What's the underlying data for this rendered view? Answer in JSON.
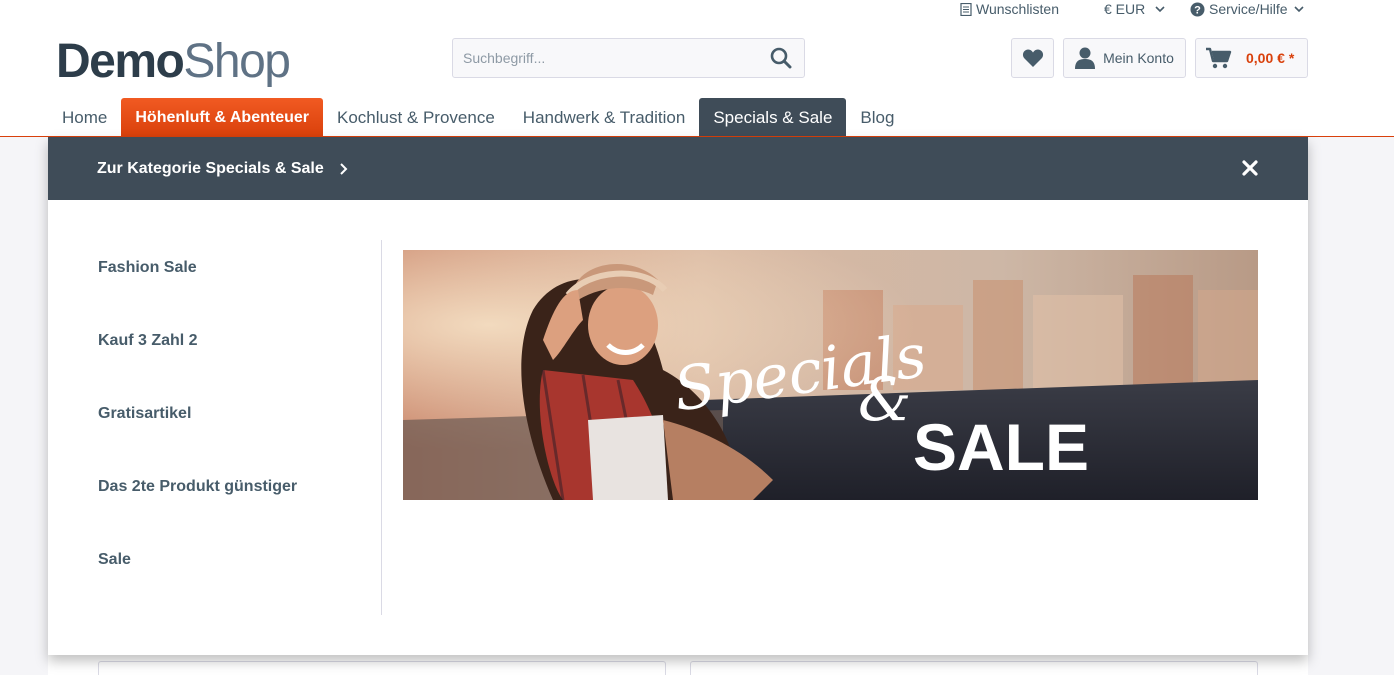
{
  "topbar": {
    "wishlist_label": "Wunschlisten",
    "currency_label": "€ EUR",
    "service_label": "Service/Hilfe"
  },
  "logo": {
    "part1": "Demo",
    "part2": "Shop"
  },
  "search": {
    "placeholder": "Suchbegriff..."
  },
  "header": {
    "account_label": "Mein Konto",
    "cart_amount": "0,00 € *"
  },
  "nav": {
    "items": [
      {
        "label": "Home"
      },
      {
        "label": "Höhenluft & Abenteuer"
      },
      {
        "label": "Kochlust & Provence"
      },
      {
        "label": "Handwerk & Tradition"
      },
      {
        "label": "Specials & Sale"
      },
      {
        "label": "Blog"
      }
    ]
  },
  "mega": {
    "category_link": "Zur Kategorie Specials & Sale",
    "subcategories": [
      {
        "label": "Fashion Sale"
      },
      {
        "label": "Kauf 3 Zahl 2"
      },
      {
        "label": "Gratisartikel"
      },
      {
        "label": "Das 2te Produkt günstiger"
      },
      {
        "label": "Sale"
      }
    ],
    "teaser": {
      "script_text": "Specials",
      "amp": "&",
      "big_text": "SALE"
    }
  },
  "colors": {
    "accent": "#d9400b",
    "nav_active": "#3f4c58",
    "text": "#475c6a"
  },
  "icons": [
    "list-icon",
    "chevron-down-icon",
    "help-icon",
    "search-icon",
    "heart-icon",
    "user-icon",
    "cart-icon",
    "chevron-right-icon",
    "close-icon"
  ]
}
